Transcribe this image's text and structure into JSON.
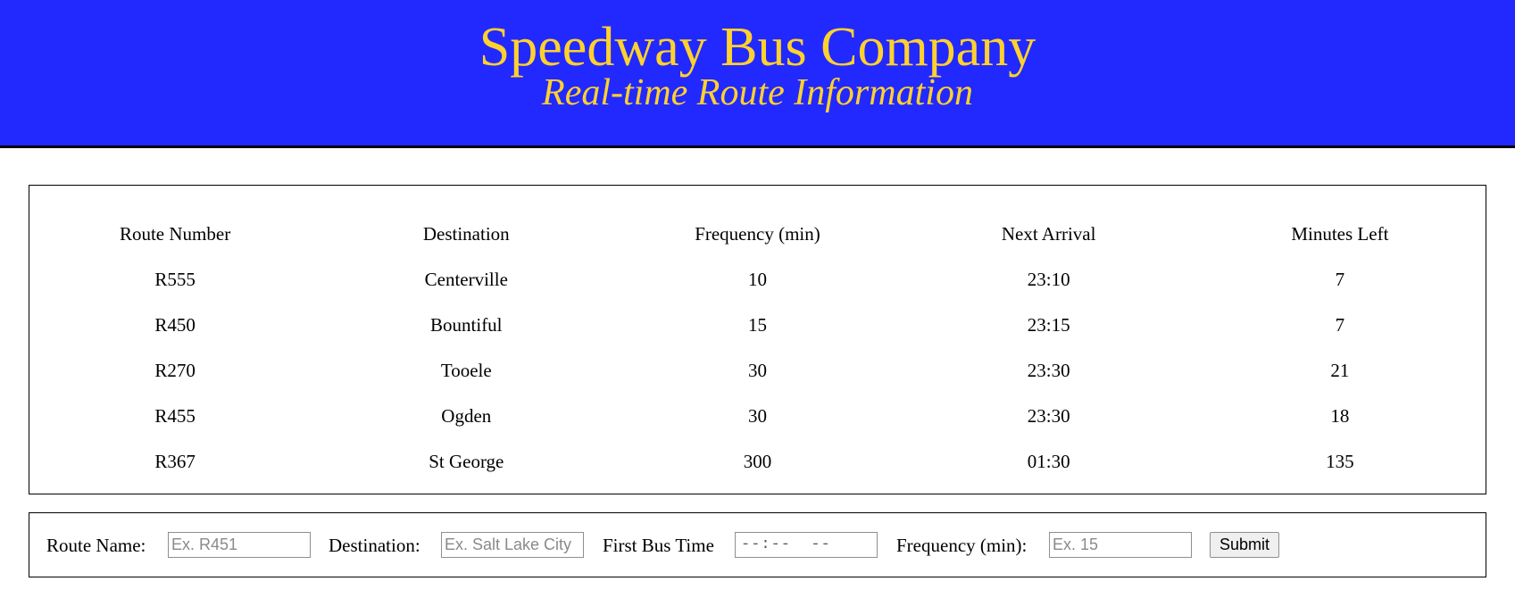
{
  "header": {
    "title": "Speedway Bus Company",
    "subtitle": "Real-time Route Information",
    "background_color": "#2229ff",
    "text_color": "#ffd12e"
  },
  "routes_table": {
    "columns": [
      "Route Number",
      "Destination",
      "Frequency (min)",
      "Next Arrival",
      "Minutes Left"
    ],
    "rows": [
      [
        "R555",
        "Centerville",
        "10",
        "23:10",
        "7"
      ],
      [
        "R450",
        "Bountiful",
        "15",
        "23:15",
        "7"
      ],
      [
        "R270",
        "Tooele",
        "30",
        "23:30",
        "21"
      ],
      [
        "R455",
        "Ogden",
        "30",
        "23:30",
        "18"
      ],
      [
        "R367",
        "St George",
        "300",
        "01:30",
        "135"
      ]
    ]
  },
  "form": {
    "route_name_label": "Route Name:",
    "route_name_placeholder": "Ex. R451",
    "route_name_value": "",
    "destination_label": "Destination:",
    "destination_placeholder": "Ex. Salt Lake City",
    "destination_value": "",
    "first_bus_time_label": "First Bus Time",
    "first_bus_time_display": "--:--  --",
    "frequency_label": "Frequency (min):",
    "frequency_placeholder": "Ex. 15",
    "frequency_value": "",
    "submit_label": "Submit"
  }
}
